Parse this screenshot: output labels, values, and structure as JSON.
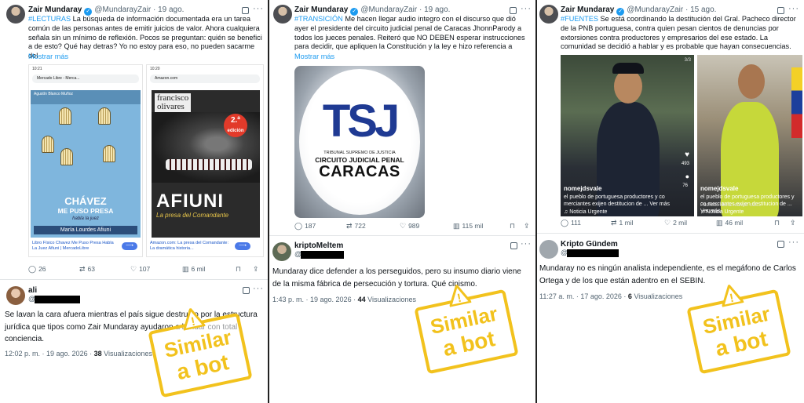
{
  "colors": {
    "link": "#1d9bf0",
    "stamp": "#f2c21d",
    "verified": "#1d9bf0"
  },
  "panels": [
    {
      "tweet": {
        "name": "Zair Mundaray",
        "handle": "@MundarayZair",
        "date": "· 19 ago.",
        "hashtag": "#LECTURAS",
        "text": " La búsqueda de información documentada era un tarea común de las personas antes de emitir juicios de valor. Ahora cualquiera señala sin un mínimo de reflexión. Pocos se preguntan: quién se benefici a de esto? Qué hay detras? Yo no estoy para eso, no pueden sacarme del",
        "show_more": "Mostrar más",
        "media": {
          "left": {
            "status_time": "10:21",
            "url": "Mercado Libre - Merca...",
            "book_author": "Agustín Blanco Muñoz",
            "book_title_1": "CHÁVEZ",
            "book_title_2": "ME PUSO PRESA",
            "book_subtitle": "habla la juez",
            "book_name": "María Lourdes Afiuni",
            "caption": "Libro Físico Chavez Me Puso Presa Habla La Juez Afiuni | MercadoLibre"
          },
          "right": {
            "status_time": "10:20",
            "url": "Amazon.com",
            "author_1": "francisco",
            "author_2": "olivares",
            "edition_1": "2.ª",
            "edition_2": "edición",
            "title": "AFIUNI",
            "subtitle": "La presa del Comandante",
            "caption": "Amazon.com: La presa del Comandante: La dramática historia..."
          }
        },
        "actions": {
          "replies": "26",
          "reposts": "63",
          "likes": "107",
          "views": "6 mil"
        }
      },
      "reply": {
        "name": "ali",
        "at": "@",
        "text": "Se lavan la cara afuera mientras el país sigue destruido por la estructura jurídica que tipos como Zair Mundaray ayudaron a blindar con total conciencia.",
        "time": "12:02 p. m. · 19 ago. 2026 ·",
        "views": "38",
        "views_label": " Visualizaciones"
      },
      "stamp": {
        "line1": "Similar",
        "line2": "a bot"
      }
    },
    {
      "tweet": {
        "name": "Zair Mundaray",
        "handle": "@MundarayZair",
        "date": "· 19 ago.",
        "hashtag": "#TRANSICIÓN",
        "text": " Me hacen llegar audio integro con el discurso que dió ayer el presidente del circuito judicial penal de Caracas JhonnParody a todos los jueces penales. Reiteró que  NO DEBEN esperar instrucciones para decidir, que apliquen la Constitución y la ley e hizo referencia a",
        "show_more": "Mostrar más",
        "media": {
          "logo": "TSJ",
          "line1": "TRIBUNAL SUPREMO DE JUSTICIA",
          "line2": "CIRCUITO JUDICIAL PENAL",
          "line3": "CARACAS"
        },
        "actions": {
          "replies": "187",
          "reposts": "722",
          "likes": "989",
          "views": "115 mil"
        }
      },
      "reply": {
        "name": "kriptoMeltem",
        "at": "@",
        "text": "Mundaray dice defender a los perseguidos, pero su insumo diario viene de la misma fábrica de persecución y tortura. Qué cinismo.",
        "time": "1:43 p. m. · 19 ago. 2026 ·",
        "views": "44",
        "views_label": " Visualizaciones"
      },
      "stamp": {
        "line1": "Similar",
        "line2": "a bot"
      }
    },
    {
      "tweet": {
        "name": "Zair Mundaray",
        "handle": "@MundarayZair",
        "date": "· 15 ago.",
        "hashtag": "#FUENTES",
        "text": " Se está coordinando la destitución del Gral. Pacheco director de la PNB portuguesa, contra quien pesan cientos de denuncias por extorsiones contra productores y empresarios del ese estado. La comunidad se decidió a hablar y es probable que hayan consecuencias.",
        "media": {
          "left": {
            "counter": "3/3",
            "user": "nomejdsvale",
            "caption": "el pueblo de portuguesa productores y co merciantes exijen destitucion de ... Ver más",
            "tag": "♫ Noticia Urgente",
            "likes": "493",
            "comments": "76"
          },
          "right": {
            "user": "nomejdsvale",
            "caption": "el pueblo de portuguesa productores y co merciantes exijen destitucion de ... Ver más",
            "overlay_text": "Pacheco libera reunión con...",
            "tag": "♫ Noticia Urgente"
          }
        },
        "actions": {
          "replies": "111",
          "reposts": "1 mil",
          "likes": "2 mil",
          "views": "46 mil"
        }
      },
      "reply": {
        "name": "Kripto Gündem",
        "at": "@",
        "text": "Mundaray no es ningún analista independiente, es el megáfono de Carlos Ortega y de los que están adentro en el SEBIN.",
        "time": "11:27 a. m. · 17 ago. 2026 ·",
        "views": "6",
        "views_label": " Visualizaciones"
      },
      "stamp": {
        "line1": "Similar",
        "line2": "a bot"
      }
    }
  ]
}
